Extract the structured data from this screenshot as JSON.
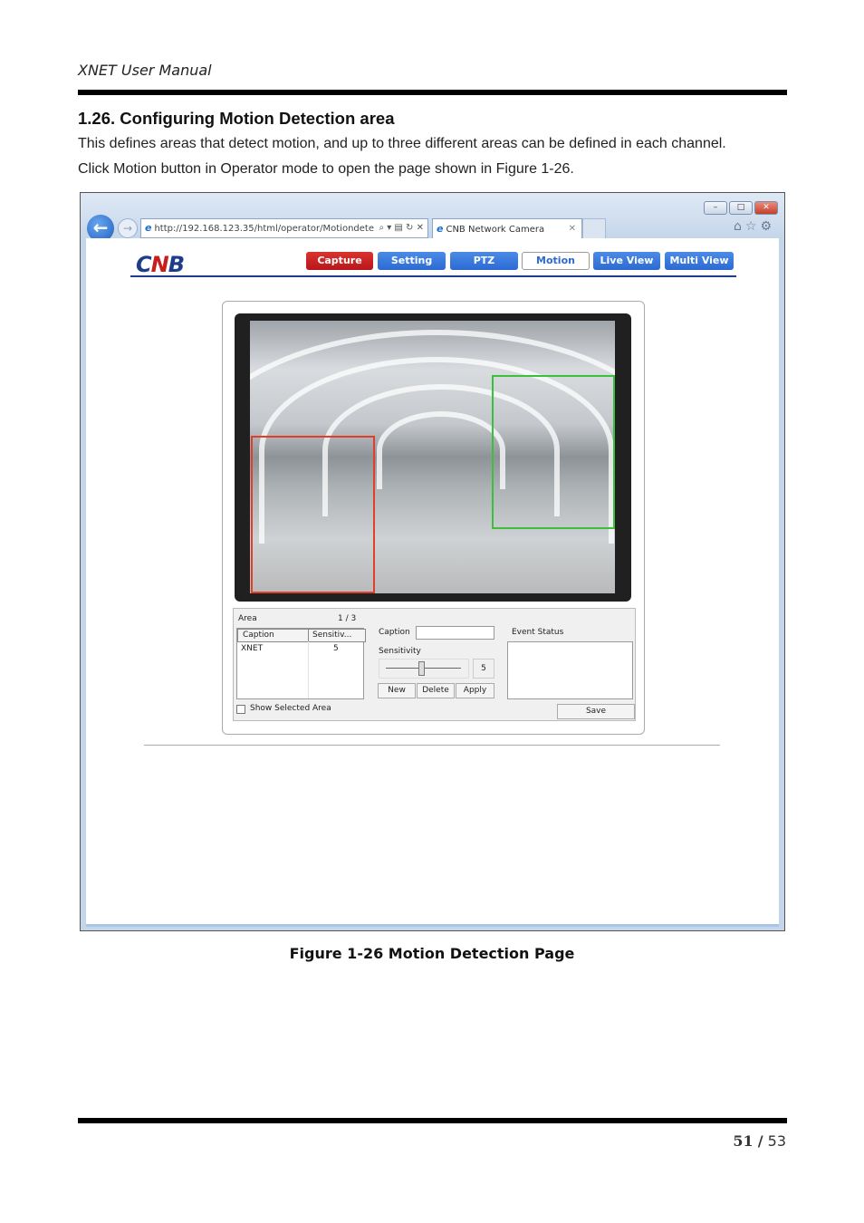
{
  "header": {
    "title": "XNET User Manual"
  },
  "section": {
    "heading": "1.26. Configuring Motion Detection area",
    "paragraphs": [
      "This defines areas that detect motion, and up to three different areas can be defined in each channel.",
      "Click Motion button in Operator mode to open the page shown in Figure 1-26."
    ]
  },
  "browser": {
    "url": "http://192.168.123.35/html/operator/Motiondete",
    "tab_title": "CNB Network Camera",
    "window_buttons": [
      "minimize-icon",
      "restore-icon",
      "close-icon"
    ],
    "toolbar_icons": [
      "home-icon",
      "star-icon",
      "gear-icon"
    ]
  },
  "app": {
    "logo": "CNB",
    "nav": [
      {
        "label": "Capture",
        "color": "#c81e1e"
      },
      {
        "label": "Setting",
        "color": "#2c6ad3"
      },
      {
        "label": "PTZ",
        "color": "#2c6ad3"
      },
      {
        "label": "Motion",
        "color": "#ffffff",
        "active": true
      },
      {
        "label": "Live View",
        "color": "#2c6ad3"
      },
      {
        "label": "Multi View",
        "color": "#2c6ad3"
      }
    ]
  },
  "motion": {
    "area_label": "Area",
    "area_count": "1 / 3",
    "columns": [
      "Caption",
      "Sensitiv..."
    ],
    "rows": [
      {
        "caption": "XNET",
        "sensitivity": "5"
      }
    ],
    "caption_label": "Caption",
    "caption_value": "",
    "sensitivity_label": "Sensitivity",
    "sensitivity_value": "5",
    "sensitivity_fraction": 0.45,
    "buttons": {
      "new": "New",
      "delete": "Delete",
      "apply": "Apply",
      "save": "Save"
    },
    "show_selected_label": "Show Selected Area",
    "show_selected_checked": false,
    "event_status_label": "Event Status",
    "zone_colors": [
      "#e0402a",
      "#3cc03c"
    ]
  },
  "figure_caption": "Figure 1-26 Motion Detection Page",
  "footer": {
    "page": "51",
    "separator": "/",
    "total": "53"
  }
}
